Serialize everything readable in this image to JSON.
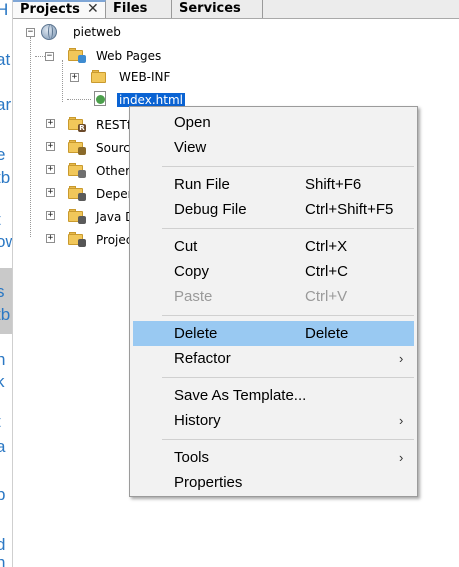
{
  "left_strip": {
    "fragments": [
      "H",
      "at",
      "ar",
      "e",
      "tb",
      "t",
      "ow",
      "s",
      "tb",
      "n",
      "k",
      "t",
      "a",
      "p",
      "d",
      "n"
    ]
  },
  "tabs": [
    {
      "label": "Projects",
      "active": true,
      "close": "✕"
    },
    {
      "label": "Files",
      "active": false
    },
    {
      "label": "Services",
      "active": false
    }
  ],
  "tree": {
    "root": {
      "label": "pietweb",
      "expander": "−"
    },
    "web_pages": {
      "label": "Web Pages",
      "expander": "−"
    },
    "web_inf": {
      "label": "WEB-INF",
      "expander": "+"
    },
    "index": {
      "label": "index.html",
      "selected": true
    },
    "siblings": [
      {
        "label": "RESTf",
        "expander": "+",
        "badge": "R",
        "badge_color": "#6b4a2a"
      },
      {
        "label": "Sourc",
        "expander": "+",
        "badge": "",
        "badge_color": "#8a6a2a"
      },
      {
        "label": "Other",
        "expander": "+",
        "badge": "",
        "badge_color": "#6f6f6f"
      },
      {
        "label": "Depen",
        "expander": "+",
        "badge": "",
        "badge_color": "#5a5a5a"
      },
      {
        "label": "Java D",
        "expander": "+",
        "badge": "",
        "badge_color": "#5a5a5a"
      },
      {
        "label": "Projec",
        "expander": "+",
        "badge": "",
        "badge_color": "#555"
      }
    ]
  },
  "context_menu": {
    "groups": [
      [
        {
          "label": "Open",
          "accel": "",
          "submenu": false,
          "disabled": false
        },
        {
          "label": "View",
          "accel": "",
          "submenu": false,
          "disabled": false
        }
      ],
      [
        {
          "label": "Run File",
          "accel": "Shift+F6",
          "submenu": false,
          "disabled": false
        },
        {
          "label": "Debug File",
          "accel": "Ctrl+Shift+F5",
          "submenu": false,
          "disabled": false
        }
      ],
      [
        {
          "label": "Cut",
          "accel": "Ctrl+X",
          "submenu": false,
          "disabled": false
        },
        {
          "label": "Copy",
          "accel": "Ctrl+C",
          "submenu": false,
          "disabled": false
        },
        {
          "label": "Paste",
          "accel": "Ctrl+V",
          "submenu": false,
          "disabled": true
        }
      ],
      [
        {
          "label": "Delete",
          "accel": "Delete",
          "submenu": false,
          "disabled": false,
          "active": true
        },
        {
          "label": "Refactor",
          "accel": "",
          "submenu": true,
          "disabled": false
        }
      ],
      [
        {
          "label": "Save As Template...",
          "accel": "",
          "submenu": false,
          "disabled": false
        },
        {
          "label": "History",
          "accel": "",
          "submenu": true,
          "disabled": false
        }
      ],
      [
        {
          "label": "Tools",
          "accel": "",
          "submenu": true,
          "disabled": false
        },
        {
          "label": "Properties",
          "accel": "",
          "submenu": false,
          "disabled": false
        }
      ]
    ],
    "submenu_arrow": "›"
  },
  "colors": {
    "selection": "#0a63d3",
    "menu_highlight": "#99c9f2",
    "link_text": "#2b78c4"
  }
}
